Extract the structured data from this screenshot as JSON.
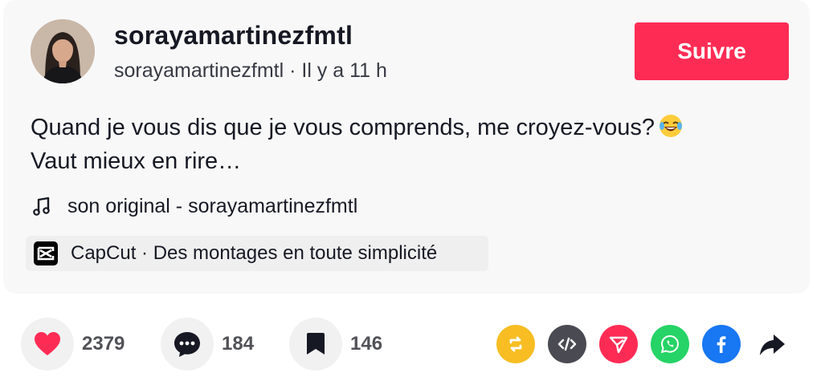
{
  "post": {
    "username": "sorayamartinezfmtl",
    "subline": "sorayamartinezfmtl · Il y a 11 h",
    "follow_label": "Suivre",
    "caption_line1": "Quand je vous dis que je vous comprends, me croyez-vous?",
    "caption_line2": "Vaut mieux en rire…",
    "caption_emoji": "face-with-tears-of-joy",
    "music": "son original - sorayamartinezfmtl",
    "capcut": "CapCut · Des montages en toute simplicité"
  },
  "actions": {
    "likes": "2379",
    "comments": "184",
    "saves": "146"
  },
  "colors": {
    "accent": "#fe2c55",
    "repost": "#f7bd23",
    "embed": "#4a4b52",
    "direct": "#fe2c55",
    "whatsapp": "#25d366",
    "facebook": "#1877f2"
  },
  "icons": [
    "heart-icon",
    "comment-icon",
    "bookmark-icon",
    "repost-icon",
    "embed-icon",
    "send-icon",
    "whatsapp-icon",
    "facebook-icon",
    "share-arrow-icon",
    "music-note-icon",
    "capcut-logo-icon"
  ]
}
